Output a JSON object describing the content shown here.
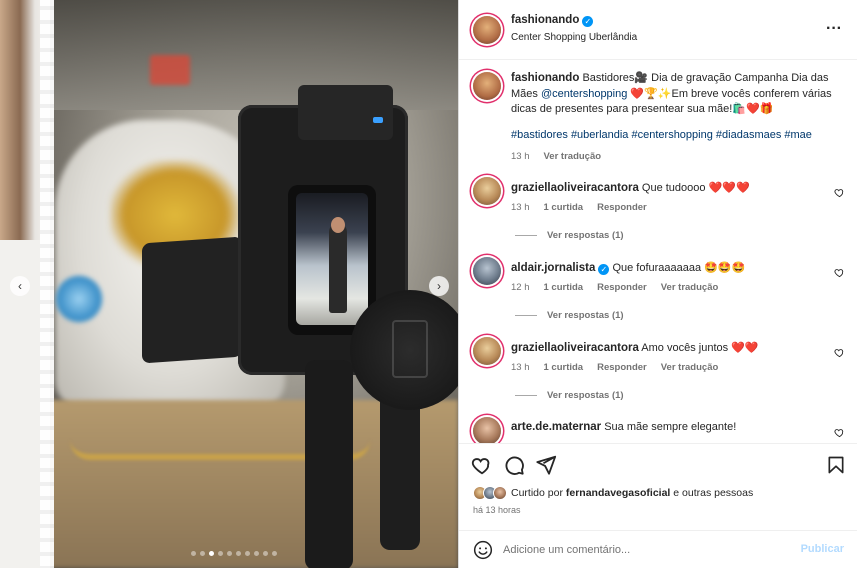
{
  "post": {
    "username": "fashionando",
    "location": "Center Shopping Uberlândia",
    "caption": {
      "text_before_mention": "Bastidores🎥 Dia de gravação Campanha Dia das Mães ",
      "mention": "@centershopping",
      "text_after_mention": " ❤️🏆✨Em breve vocês conferem várias dicas de presentes para presentear sua mãe!🛍️❤️🎁",
      "hashtags": [
        "#bastidores",
        "#uberlandia",
        "#centershopping",
        "#diadasmaes",
        "#mae"
      ],
      "time": "13 h",
      "translate": "Ver tradução"
    },
    "slides": {
      "count": 10,
      "active_index": 2
    }
  },
  "comments": [
    {
      "username": "graziellaoliveiracantora",
      "text": "Que tudoooo",
      "emoji": "❤️❤️❤️",
      "time": "13 h",
      "likes": "1 curtida",
      "reply": "Responder",
      "translate": "",
      "replies": "Ver respostas (1)"
    },
    {
      "username": "aldair.jornalista",
      "verified": true,
      "text": "Que fofuraaaaaaa",
      "emoji": "🤩🤩🤩",
      "time": "12 h",
      "likes": "1 curtida",
      "reply": "Responder",
      "translate": "Ver tradução",
      "replies": "Ver respostas (1)"
    },
    {
      "username": "graziellaoliveiracantora",
      "text": "Amo vocês juntos",
      "emoji": "❤️❤️",
      "time": "13 h",
      "likes": "1 curtida",
      "reply": "Responder",
      "translate": "Ver tradução",
      "replies": "Ver respostas (1)"
    },
    {
      "username": "arte.de.maternar",
      "text": "Sua mãe sempre elegante!",
      "emoji": ""
    }
  ],
  "likes": {
    "prefix": "Curtido por",
    "user": "fernandavegasoficial",
    "suffix": "e outras pessoas"
  },
  "post_time": "há 13 horas",
  "comment_box": {
    "placeholder": "Adicione um comentário...",
    "publish": "Publicar"
  },
  "colors": {
    "link": "#00376b",
    "heart": "#e0245e",
    "publish_disabled": "#b3dbff",
    "verified": "#0095f6"
  }
}
